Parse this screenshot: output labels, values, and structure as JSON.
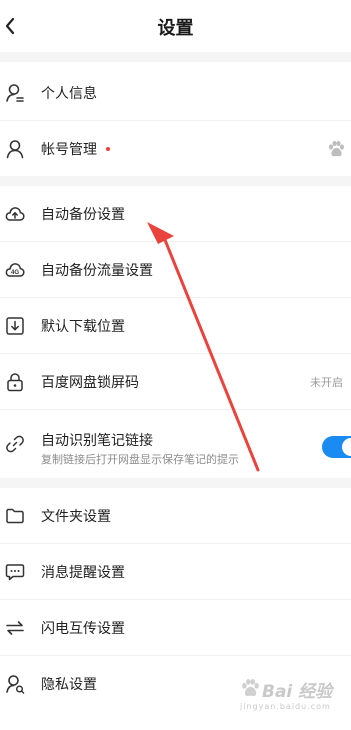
{
  "header": {
    "title": "设置"
  },
  "rows": {
    "personal_info": {
      "label": "个人信息"
    },
    "account": {
      "label": "帐号管理"
    },
    "auto_backup": {
      "label": "自动备份设置"
    },
    "backup_traffic": {
      "label": "自动备份流量设置",
      "icon_text": "4G"
    },
    "download_location": {
      "label": "默认下载位置"
    },
    "lock_screen": {
      "label": "百度网盘锁屏码",
      "value": "未开启"
    },
    "note_links": {
      "label": "自动识别笔记链接",
      "sub": "复制链接后打开网盘显示保存笔记的提示",
      "toggle_on": true
    },
    "folder": {
      "label": "文件夹设置"
    },
    "notification": {
      "label": "消息提醒设置"
    },
    "transfer": {
      "label": "闪电互传设置"
    },
    "privacy": {
      "label": "隐私设置"
    }
  },
  "colors": {
    "accent": "#1a8bf2",
    "badge": "#e8433c",
    "arrow": "#e8433c"
  },
  "watermark": {
    "main": "Bai 经验",
    "sub": "jingyan.baidu.com"
  }
}
